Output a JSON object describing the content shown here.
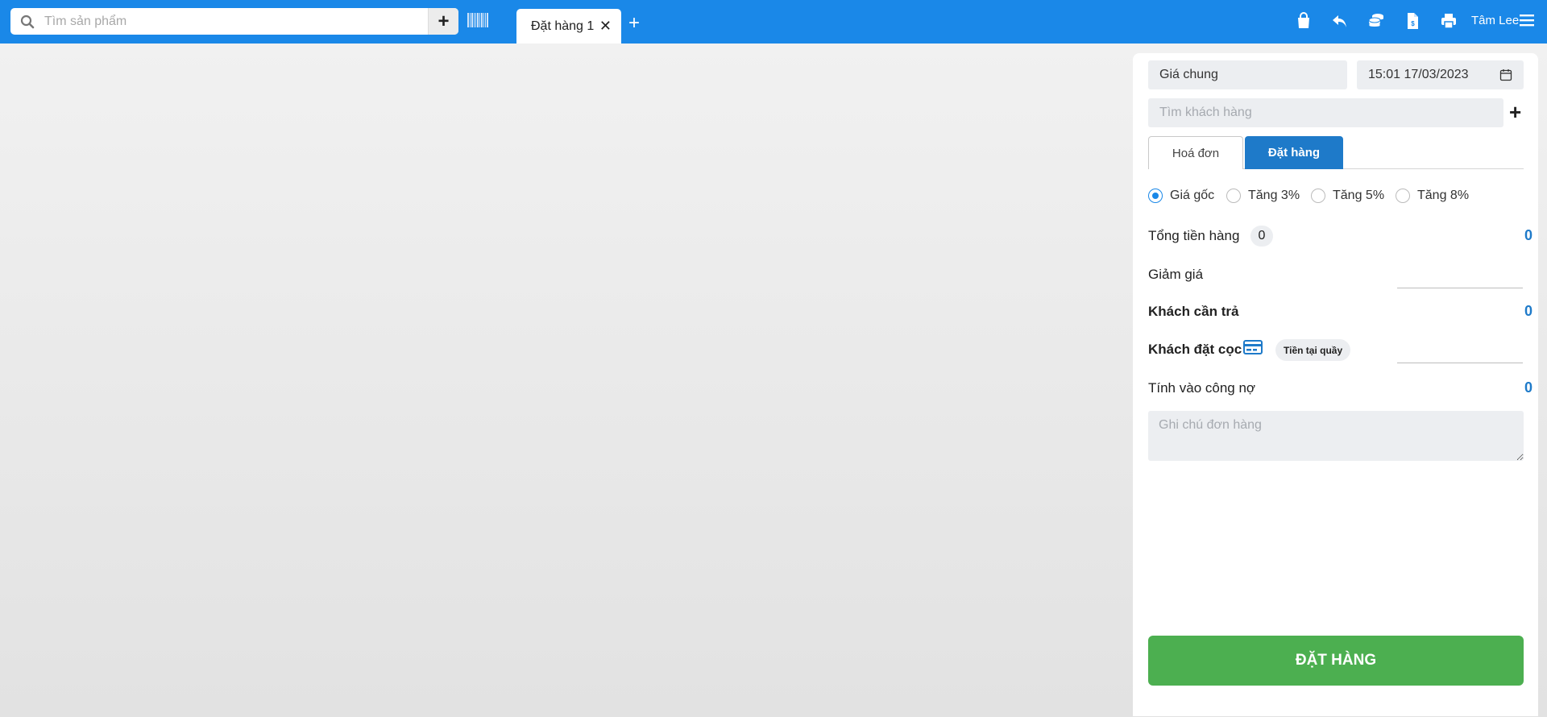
{
  "topbar": {
    "search": {
      "placeholder": "Tìm sản phẩm",
      "add_label": "+"
    },
    "tab": {
      "label": "Đặt hàng 1",
      "close_label": "✕"
    },
    "new_tab_label": "+",
    "user_name": "Tâm Lee",
    "icons": [
      "bag-icon",
      "return-icon",
      "coins-icon",
      "document-icon",
      "print-icon",
      "menu-icon"
    ]
  },
  "panel": {
    "price_list": "Giá chung",
    "datetime": "15:01 17/03/2023",
    "customer_search_placeholder": "Tìm khách hàng",
    "add_customer_label": "+",
    "tabs": [
      {
        "label": "Hoá đơn",
        "active": false
      },
      {
        "label": "Đặt hàng",
        "active": true
      }
    ],
    "price_options": [
      {
        "label": "Giá gốc",
        "checked": true
      },
      {
        "label": "Tăng 3%",
        "checked": false
      },
      {
        "label": "Tăng 5%",
        "checked": false
      },
      {
        "label": "Tăng 8%",
        "checked": false
      }
    ],
    "subtotal": {
      "label": "Tổng tiền hàng",
      "count": "0",
      "value": "0"
    },
    "discount": {
      "label": "Giảm giá",
      "value": ""
    },
    "customer_pay": {
      "label": "Khách cần trả",
      "value": "0"
    },
    "deposit": {
      "label": "Khách đặt cọc",
      "method": "Tiền tại quầy",
      "value": ""
    },
    "debt": {
      "label": "Tính vào công nợ",
      "value": "0"
    },
    "note_placeholder": "Ghi chú đơn hàng",
    "order_button": "ĐẶT HÀNG"
  },
  "colors": {
    "topbar": "#1a88e8",
    "accent": "#1e7ac9",
    "order_button": "#4caf50"
  }
}
